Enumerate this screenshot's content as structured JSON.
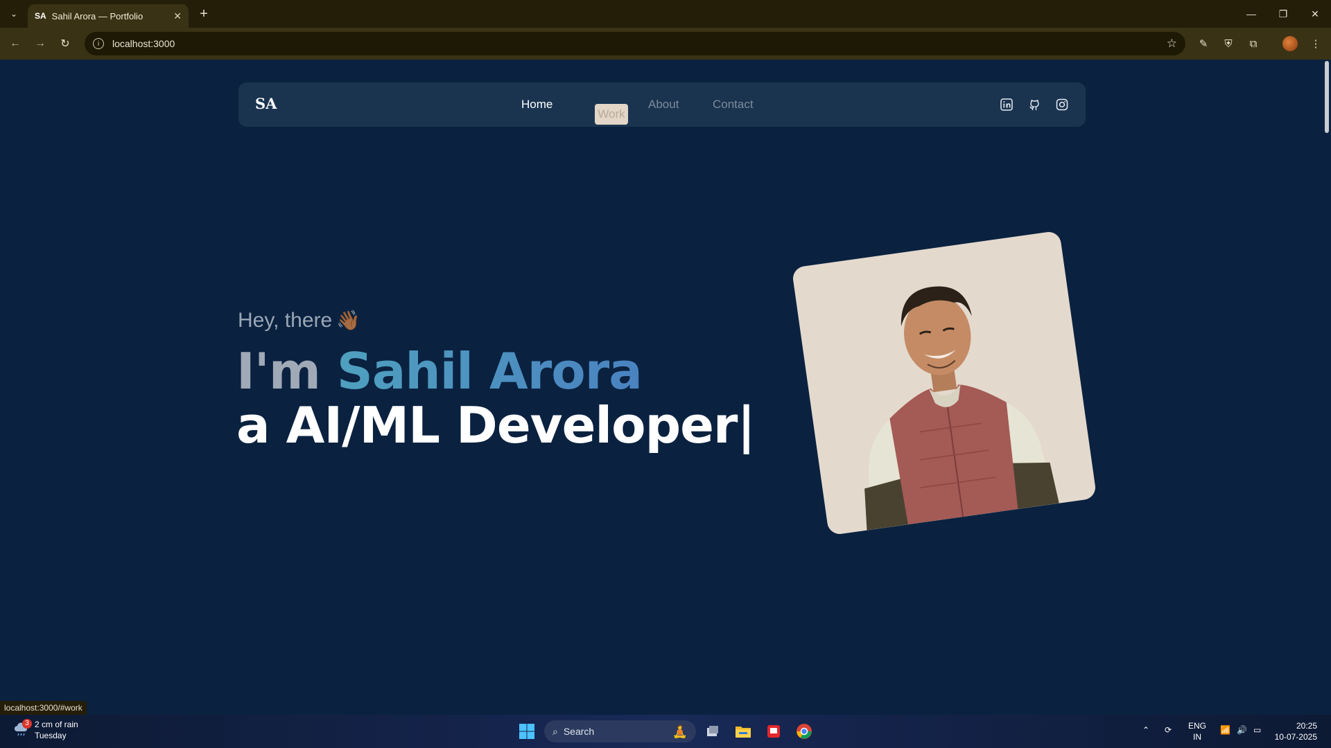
{
  "browser": {
    "tab_favicon": "SA",
    "tab_title": "Sahil Arora — Portfolio",
    "url": "localhost:3000",
    "status_url": "localhost:3000/#work"
  },
  "site": {
    "logo": "SA",
    "nav": [
      "Home",
      "Work",
      "About",
      "Contact"
    ],
    "active_nav": "Home",
    "socials": [
      "linkedin-icon",
      "github-icon",
      "instagram-icon"
    ]
  },
  "hero": {
    "greeting": "Hey, there",
    "greeting_emoji": "👋🏾",
    "im": "I'm ",
    "name": "Sahil Arora",
    "role": "a AI/ML Developer|"
  },
  "taskbar": {
    "weather_badge": "3",
    "weather_line1": "2 cm of rain",
    "weather_line2": "Tuesday",
    "search_label": "Search",
    "lang_line1": "ENG",
    "lang_line2": "IN",
    "time": "20:25",
    "date": "10-07-2025"
  },
  "colors": {
    "page_bg": "#0a2240",
    "navbar_bg": "#1a3450",
    "name_accent": "#4b90b8",
    "work_pill": "#e3d6c8"
  }
}
